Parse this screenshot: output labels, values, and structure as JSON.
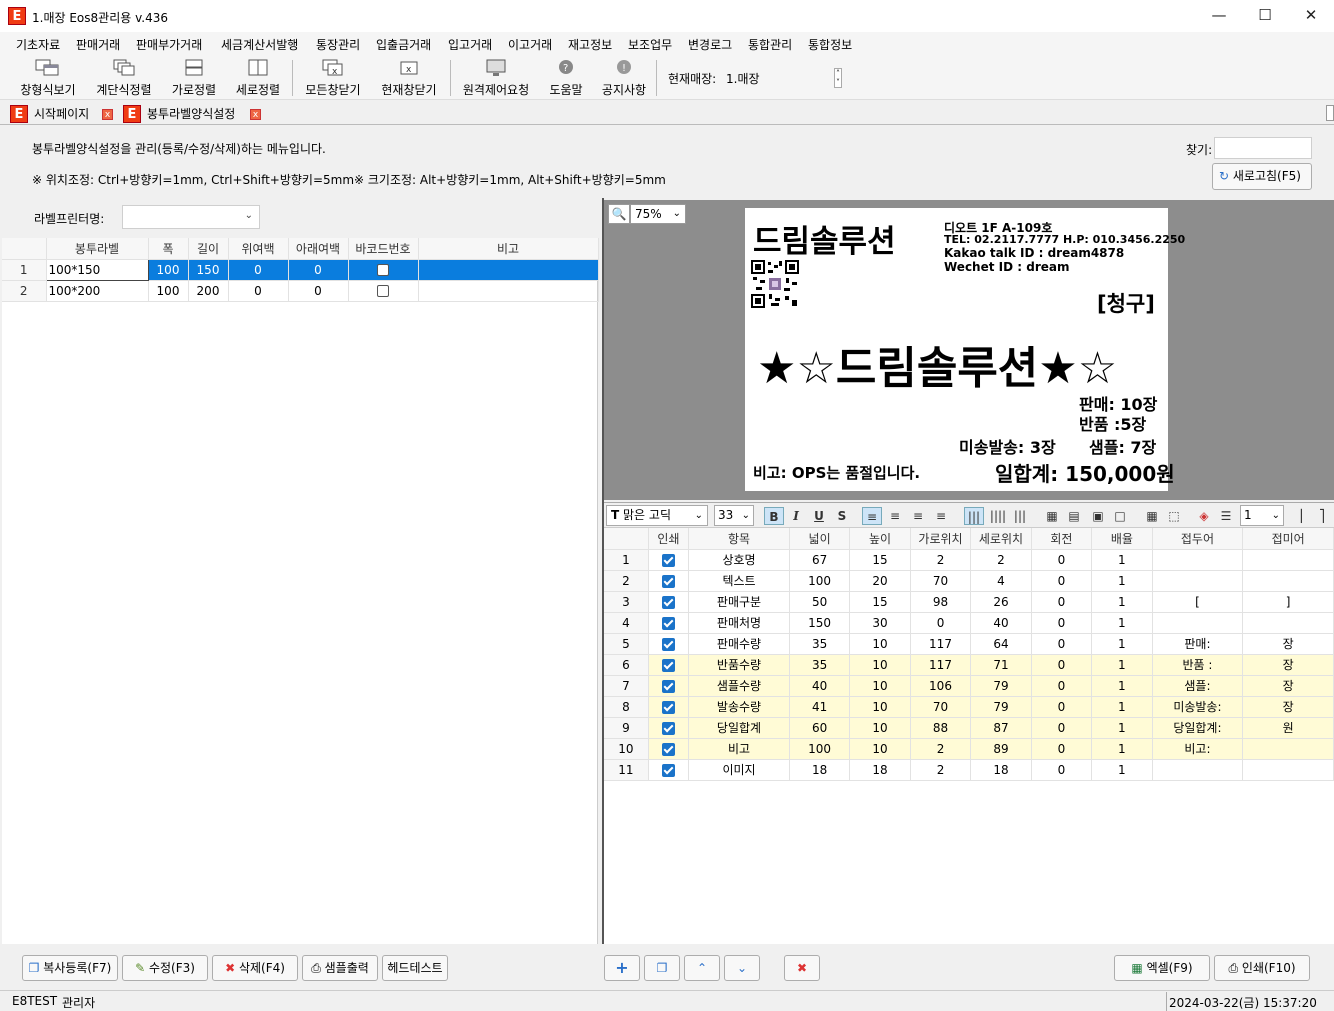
{
  "window": {
    "title": "1.매장 Eos8관리용 v.436",
    "app_icon_letter": "E"
  },
  "menu": [
    "기초자료",
    "판매거래",
    "판매부가거래",
    "세금계산서발행",
    "통장관리",
    "입출금거래",
    "입고거래",
    "이고거래",
    "재고정보",
    "보조업무",
    "변경로그",
    "통합관리",
    "통합정보"
  ],
  "toolbar": {
    "buttons": [
      "창형식보기",
      "계단식정렬",
      "가로정렬",
      "세로정렬",
      "모든창닫기",
      "현재창닫기",
      "원격제어요청",
      "도움말",
      "공지사항"
    ],
    "store_label": "현재매장:",
    "store_value": "1.매장"
  },
  "tabs": [
    {
      "label": "시작페이지"
    },
    {
      "label": "봉투라벨양식설정"
    }
  ],
  "header": {
    "description": "봉투라벨양식설정을 관리(등록/수정/삭제)하는 메뉴입니다.",
    "hint_move": "※ 위치조정: Ctrl+방향키=1mm, Ctrl+Shift+방향키=5mm",
    "hint_size": "※ 크기조정: Alt+방향키=1mm, Alt+Shift+방향키=5mm",
    "search_label": "찾기:",
    "search_value": "",
    "refresh_button": "새로고침(F5)"
  },
  "printer": {
    "label": "라벨프린터명:",
    "value": ""
  },
  "left_grid": {
    "columns": [
      "봉투라벨",
      "폭",
      "길이",
      "위여백",
      "아래여백",
      "바코드번호",
      "비고"
    ],
    "rows": [
      {
        "no": "1",
        "name": "100*150",
        "width": "100",
        "length": "150",
        "top": "0",
        "bottom": "0",
        "barcode": false,
        "note": ""
      },
      {
        "no": "2",
        "name": "100*200",
        "width": "100",
        "length": "200",
        "top": "0",
        "bottom": "0",
        "barcode": false,
        "note": ""
      }
    ]
  },
  "zoom": "75%",
  "label_preview": {
    "company": "드림솔루션",
    "addr": "디오트  1F  A-109호",
    "tel": "TEL: 02.2117.7777  H.P: 010.3456.2250",
    "kakao": "Kakao talk ID : dream4878",
    "wechat": "Wechet ID : dream",
    "billing": "[청구]",
    "big_name": "★☆드림솔루션★☆",
    "sale": "판매: 10장",
    "return": "반품 :5장",
    "unsent": "미송발송: 3장",
    "sample": "샘플: 7장",
    "note": "비고: OPS는 품절입니다.",
    "total": "일합계: 150,000원"
  },
  "format_bar": {
    "font": "맑은 고딕",
    "size": "33",
    "spin": "1"
  },
  "right_grid": {
    "columns": [
      "인쇄",
      "항목",
      "넓이",
      "높이",
      "가로위치",
      "세로위치",
      "회전",
      "배율",
      "접두어",
      "접미어"
    ],
    "rows": [
      {
        "no": "1",
        "item": "상호명",
        "w": "67",
        "h": "15",
        "x": "2",
        "y": "2",
        "rot": "0",
        "scale": "1",
        "prefix": "",
        "suffix": "",
        "hl": false
      },
      {
        "no": "2",
        "item": "텍스트",
        "w": "100",
        "h": "20",
        "x": "70",
        "y": "4",
        "rot": "0",
        "scale": "1",
        "prefix": "",
        "suffix": "",
        "hl": false
      },
      {
        "no": "3",
        "item": "판매구분",
        "w": "50",
        "h": "15",
        "x": "98",
        "y": "26",
        "rot": "0",
        "scale": "1",
        "prefix": "[",
        "suffix": "]",
        "hl": false
      },
      {
        "no": "4",
        "item": "판매처명",
        "w": "150",
        "h": "30",
        "x": "0",
        "y": "40",
        "rot": "0",
        "scale": "1",
        "prefix": "",
        "suffix": "",
        "hl": false
      },
      {
        "no": "5",
        "item": "판매수량",
        "w": "35",
        "h": "10",
        "x": "117",
        "y": "64",
        "rot": "0",
        "scale": "1",
        "prefix": "판매:",
        "suffix": "장",
        "hl": false
      },
      {
        "no": "6",
        "item": "반품수량",
        "w": "35",
        "h": "10",
        "x": "117",
        "y": "71",
        "rot": "0",
        "scale": "1",
        "prefix": "반품 :",
        "suffix": "장",
        "hl": true
      },
      {
        "no": "7",
        "item": "샘플수량",
        "w": "40",
        "h": "10",
        "x": "106",
        "y": "79",
        "rot": "0",
        "scale": "1",
        "prefix": "샘플:",
        "suffix": "장",
        "hl": true
      },
      {
        "no": "8",
        "item": "발송수량",
        "w": "41",
        "h": "10",
        "x": "70",
        "y": "79",
        "rot": "0",
        "scale": "1",
        "prefix": "미송발송:",
        "suffix": "장",
        "hl": true
      },
      {
        "no": "9",
        "item": "당일합계",
        "w": "60",
        "h": "10",
        "x": "88",
        "y": "87",
        "rot": "0",
        "scale": "1",
        "prefix": "당일합계:",
        "suffix": "원",
        "hl": true
      },
      {
        "no": "10",
        "item": "비고",
        "w": "100",
        "h": "10",
        "x": "2",
        "y": "89",
        "rot": "0",
        "scale": "1",
        "prefix": "비고:",
        "suffix": "",
        "hl": true
      },
      {
        "no": "11",
        "item": "이미지",
        "w": "18",
        "h": "18",
        "x": "2",
        "y": "18",
        "rot": "0",
        "scale": "1",
        "prefix": "",
        "suffix": "",
        "hl": false
      }
    ]
  },
  "bottom_left_buttons": [
    "복사등록(F7)",
    "수정(F3)",
    "삭제(F4)",
    "샘플출력",
    "헤드테스트"
  ],
  "bottom_right_buttons": {
    "excel": "엑셀(F9)",
    "print": "인쇄(F10)"
  },
  "status": {
    "user_code": "E8TEST",
    "user_role": "관리자",
    "datetime": "2024-03-22(금) 15:37:20"
  },
  "colors": {
    "selection": "#0a7dde",
    "highlight_row": "#fffbd6",
    "app_icon": "#f03c14",
    "checkbox": "#1a73c9"
  }
}
